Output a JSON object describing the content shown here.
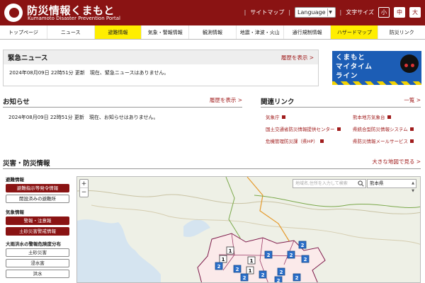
{
  "header": {
    "title": "防災情報くまもと",
    "subtitle": "Kumamoto Disaster Prevention Portal",
    "sitemap": "サイトマップ",
    "language": "Language",
    "font_size_label": "文字サイズ",
    "font_small": "小",
    "font_medium": "中",
    "font_large": "大"
  },
  "nav": [
    {
      "label": "トップページ",
      "highlight": false
    },
    {
      "label": "ニュース",
      "highlight": false
    },
    {
      "label": "避難情報",
      "highlight": true
    },
    {
      "label": "気象・警報情報",
      "highlight": false
    },
    {
      "label": "観測情報",
      "highlight": false
    },
    {
      "label": "地震・津波・火山",
      "highlight": false
    },
    {
      "label": "通行規制情報",
      "highlight": false
    },
    {
      "label": "ハザードマップ",
      "highlight": true
    },
    {
      "label": "防災リンク",
      "highlight": false
    }
  ],
  "urgent": {
    "title": "緊急ニュース",
    "history": "履歴を表示 >",
    "message": "2024年08月09日 22時51分 更新　現在、緊急ニュースはありません。"
  },
  "banner": {
    "line1": "くまもと",
    "line2": "マイタイム",
    "line3": "ライン"
  },
  "notice": {
    "title": "お知らせ",
    "history": "履歴を表示 >",
    "message": "2024年08月09日 22時51分 更新　現在、お知らせはありません。"
  },
  "related": {
    "title": "関連リンク",
    "list": "一覧 >",
    "links": [
      "気象庁",
      "熊本地方気象台",
      "国土交通省防災情報提供センター",
      "県統合型防災情報システム",
      "危機管理防災課（県HP）",
      "県防災情報メールサービス"
    ]
  },
  "disaster": {
    "title": "災害・防災情報",
    "big_map": "大きな地図で見る >",
    "evac_label": "避難情報",
    "evac_btn1": "避難指示等発令情報",
    "evac_btn2": "開設済みの避難所",
    "weather_label": "気象情報",
    "weather_btn1": "警報・注意報",
    "weather_btn2": "土砂災害警戒情報",
    "flood_label": "大雨洪水の警報危険度分布",
    "flood_btn1": "土砂災害",
    "flood_btn2": "浸水害",
    "flood_btn3": "洪水"
  },
  "map": {
    "zoom_in": "+",
    "zoom_out": "−",
    "search_placeholder": "地域名,住所を入力して検索",
    "prefecture": "熊本県",
    "markers": [
      "1",
      "1",
      "1",
      "1",
      "2",
      "2",
      "2",
      "2",
      "2",
      "2",
      "2",
      "2",
      "2",
      "2",
      "2"
    ]
  },
  "colors": {
    "brand": "#8a1313",
    "highlight": "#ffee00",
    "banner": "#1c5db5",
    "marker": "#2a6fc9"
  }
}
